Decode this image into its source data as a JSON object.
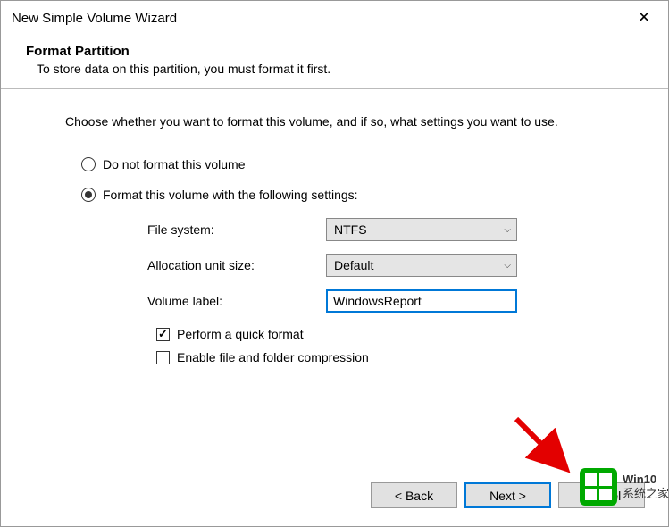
{
  "window": {
    "title": "New Simple Volume Wizard"
  },
  "header": {
    "title": "Format Partition",
    "subtitle": "To store data on this partition, you must format it first."
  },
  "intro": "Choose whether you want to format this volume, and if so, what settings you want to use.",
  "radios": {
    "no_format": "Do not format this volume",
    "format_with": "Format this volume with the following settings:"
  },
  "fields": {
    "fs_label": "File system:",
    "fs_value": "NTFS",
    "alloc_label": "Allocation unit size:",
    "alloc_value": "Default",
    "vol_label": "Volume label:",
    "vol_value": "WindowsReport"
  },
  "checks": {
    "quick": "Perform a quick format",
    "compress": "Enable file and folder compression"
  },
  "buttons": {
    "back": "< Back",
    "next": "Next >",
    "cancel": "Cancel"
  },
  "watermark": {
    "line1": "Win10",
    "line2": "系统之家"
  }
}
